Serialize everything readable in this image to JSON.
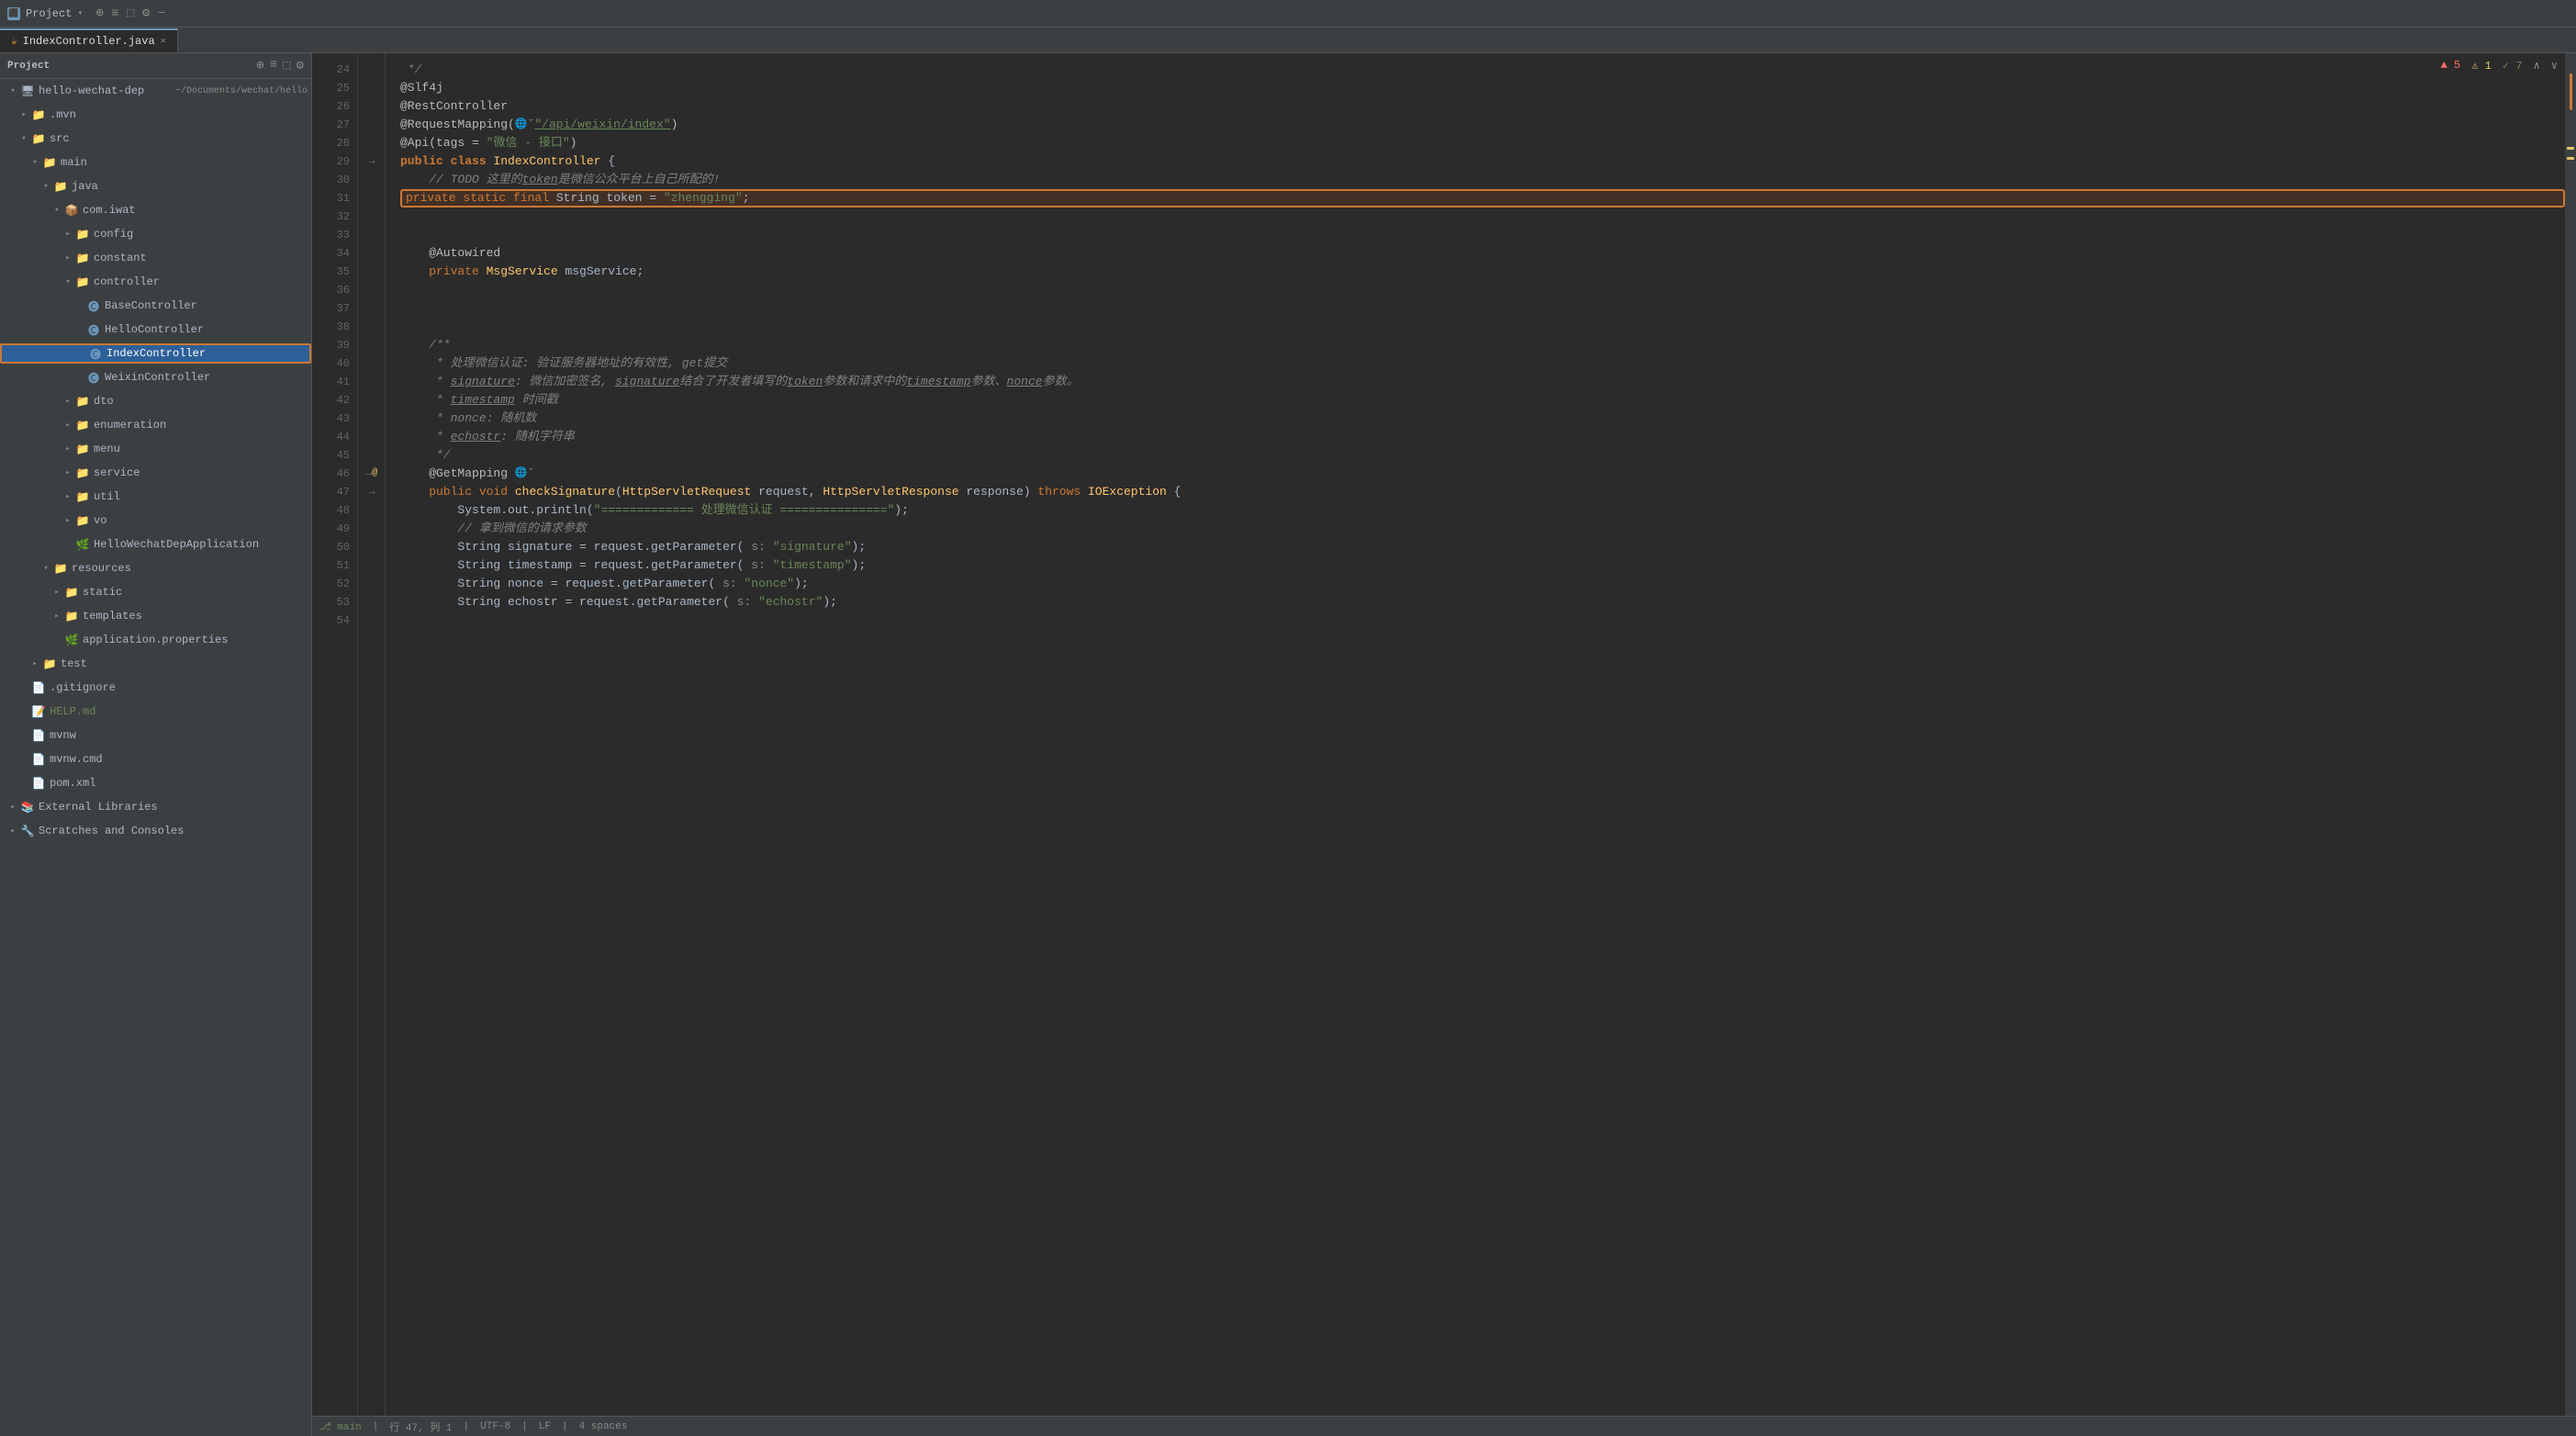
{
  "titleBar": {
    "projectLabel": "Project",
    "projectIcon": "⬛"
  },
  "tabs": [
    {
      "name": "IndexController.java",
      "active": true,
      "icon": "☕",
      "canClose": true
    }
  ],
  "sidebar": {
    "title": "Project",
    "tree": [
      {
        "id": "hello-wechat-dep",
        "label": "hello-wechat-dep",
        "indent": 0,
        "type": "project",
        "open": true,
        "detail": "~/Documents/wechat/hello"
      },
      {
        "id": "mvn",
        "label": ".mvn",
        "indent": 1,
        "type": "folder",
        "open": false
      },
      {
        "id": "src",
        "label": "src",
        "indent": 1,
        "type": "src-folder",
        "open": true
      },
      {
        "id": "main",
        "label": "main",
        "indent": 2,
        "type": "folder",
        "open": true
      },
      {
        "id": "java",
        "label": "java",
        "indent": 3,
        "type": "java-folder",
        "open": true
      },
      {
        "id": "com.iwat",
        "label": "com.iwat",
        "indent": 4,
        "type": "package",
        "open": true
      },
      {
        "id": "config",
        "label": "config",
        "indent": 5,
        "type": "folder",
        "open": false
      },
      {
        "id": "constant",
        "label": "constant",
        "indent": 5,
        "type": "folder",
        "open": false
      },
      {
        "id": "controller",
        "label": "controller",
        "indent": 5,
        "type": "folder",
        "open": true
      },
      {
        "id": "BaseController",
        "label": "BaseController",
        "indent": 6,
        "type": "class",
        "selected": false
      },
      {
        "id": "HelloController",
        "label": "HelloController",
        "indent": 6,
        "type": "class",
        "selected": false
      },
      {
        "id": "IndexController",
        "label": "IndexController",
        "indent": 6,
        "type": "class",
        "selected": true
      },
      {
        "id": "WeixinController",
        "label": "WeixinController",
        "indent": 6,
        "type": "class",
        "selected": false
      },
      {
        "id": "dto",
        "label": "dto",
        "indent": 5,
        "type": "folder",
        "open": false
      },
      {
        "id": "enumeration",
        "label": "enumeration",
        "indent": 5,
        "type": "folder",
        "open": false
      },
      {
        "id": "menu",
        "label": "menu",
        "indent": 5,
        "type": "folder",
        "open": false
      },
      {
        "id": "service",
        "label": "service",
        "indent": 5,
        "type": "folder",
        "open": false
      },
      {
        "id": "util",
        "label": "util",
        "indent": 5,
        "type": "folder",
        "open": false
      },
      {
        "id": "vo",
        "label": "vo",
        "indent": 5,
        "type": "folder",
        "open": false
      },
      {
        "id": "HelloWechatDepApplication",
        "label": "HelloWechatDepApplication",
        "indent": 5,
        "type": "appclass"
      },
      {
        "id": "resources",
        "label": "resources",
        "indent": 3,
        "type": "res-folder",
        "open": true
      },
      {
        "id": "static",
        "label": "static",
        "indent": 4,
        "type": "folder",
        "open": false
      },
      {
        "id": "templates",
        "label": "templates",
        "indent": 4,
        "type": "folder",
        "open": false
      },
      {
        "id": "application.properties",
        "label": "application.properties",
        "indent": 4,
        "type": "properties"
      },
      {
        "id": "test",
        "label": "test",
        "indent": 2,
        "type": "folder",
        "open": false
      },
      {
        "id": ".gitignore",
        "label": ".gitignore",
        "indent": 1,
        "type": "gitignore"
      },
      {
        "id": "HELP.md",
        "label": "HELP.md",
        "indent": 1,
        "type": "markdown"
      },
      {
        "id": "mvnw",
        "label": "mvnw",
        "indent": 1,
        "type": "file"
      },
      {
        "id": "mvnw.cmd",
        "label": "mvnw.cmd",
        "indent": 1,
        "type": "file"
      },
      {
        "id": "pom.xml",
        "label": "pom.xml",
        "indent": 1,
        "type": "xml"
      },
      {
        "id": "ExternalLibraries",
        "label": "External Libraries",
        "indent": 0,
        "type": "lib",
        "open": false
      },
      {
        "id": "ScratchesAndConsoles",
        "label": "Scratches and Consoles",
        "indent": 0,
        "type": "scratch",
        "open": false
      }
    ]
  },
  "editor": {
    "filename": "IndexController.java",
    "warnings": "▲ 5  ⚠ 1  ✓ 7",
    "lines": [
      {
        "num": 24,
        "content": " */",
        "type": "comment"
      },
      {
        "num": 25,
        "content": "@Slf4j",
        "type": "annotation"
      },
      {
        "num": 26,
        "content": "@RestController",
        "type": "annotation"
      },
      {
        "num": 27,
        "content": "@RequestMapping(🌐ˇ\"/api/weixin/index\")",
        "type": "code"
      },
      {
        "num": 28,
        "content": "@Api(tags = \"微信 - 接口\")",
        "type": "code"
      },
      {
        "num": 29,
        "content": "public class IndexController {",
        "type": "code",
        "marker": "arrow"
      },
      {
        "num": 30,
        "content": "    // TODO 这里的token是微信公众平台上自己所配的!",
        "type": "comment"
      },
      {
        "num": 31,
        "content": "    private static final String token = \"zhengging\";",
        "type": "code",
        "highlighted": true
      },
      {
        "num": 32,
        "content": "",
        "type": "empty"
      },
      {
        "num": 33,
        "content": "",
        "type": "empty"
      },
      {
        "num": 34,
        "content": "    @Autowired",
        "type": "annotation"
      },
      {
        "num": 35,
        "content": "    private MsgService msgService;",
        "type": "code"
      },
      {
        "num": 36,
        "content": "",
        "type": "empty"
      },
      {
        "num": 37,
        "content": "",
        "type": "empty"
      },
      {
        "num": 38,
        "content": "",
        "type": "empty"
      },
      {
        "num": 39,
        "content": "    /**",
        "type": "comment"
      },
      {
        "num": 40,
        "content": "     * 处理微信认证: 验证服务器地址的有效性, get提交",
        "type": "comment"
      },
      {
        "num": 41,
        "content": "     * signature: 微信加密签名, signature结合了开发者填写的token参数和请求中的timestamp参数、nonce参数。",
        "type": "comment"
      },
      {
        "num": 42,
        "content": "     * timestamp 时间戳",
        "type": "comment"
      },
      {
        "num": 43,
        "content": "     * nonce: 随机数",
        "type": "comment"
      },
      {
        "num": 44,
        "content": "     * echostr: 随机字符串",
        "type": "comment"
      },
      {
        "num": 45,
        "content": "     */",
        "type": "comment"
      },
      {
        "num": 46,
        "content": "    @GetMapping 🌐ˇ",
        "type": "annotation",
        "marker": "both"
      },
      {
        "num": 47,
        "content": "    public void checkSignature(HttpServletRequest request, HttpServletResponse response) throws IOException {",
        "type": "code"
      },
      {
        "num": 48,
        "content": "        System.out.println(\"============= 处理微信认证 ===============\");",
        "type": "code"
      },
      {
        "num": 49,
        "content": "        // 拿到微信的请求参数",
        "type": "comment"
      },
      {
        "num": 50,
        "content": "        String signature = request.getParameter( s: \"signature\");",
        "type": "code"
      },
      {
        "num": 51,
        "content": "        String timestamp = request.getParameter( s: \"timestamp\");",
        "type": "code"
      },
      {
        "num": 52,
        "content": "        String nonce = request.getParameter( s: \"nonce\");",
        "type": "code"
      },
      {
        "num": 53,
        "content": "        String echostr = request.getParameter( s: \"echostr\");",
        "type": "code"
      },
      {
        "num": 54,
        "content": "",
        "type": "empty"
      }
    ]
  },
  "statusBar": {
    "line": "行 47, 列 1",
    "encoding": "UTF-8",
    "lineEnding": "LF",
    "indent": "4 spaces"
  }
}
